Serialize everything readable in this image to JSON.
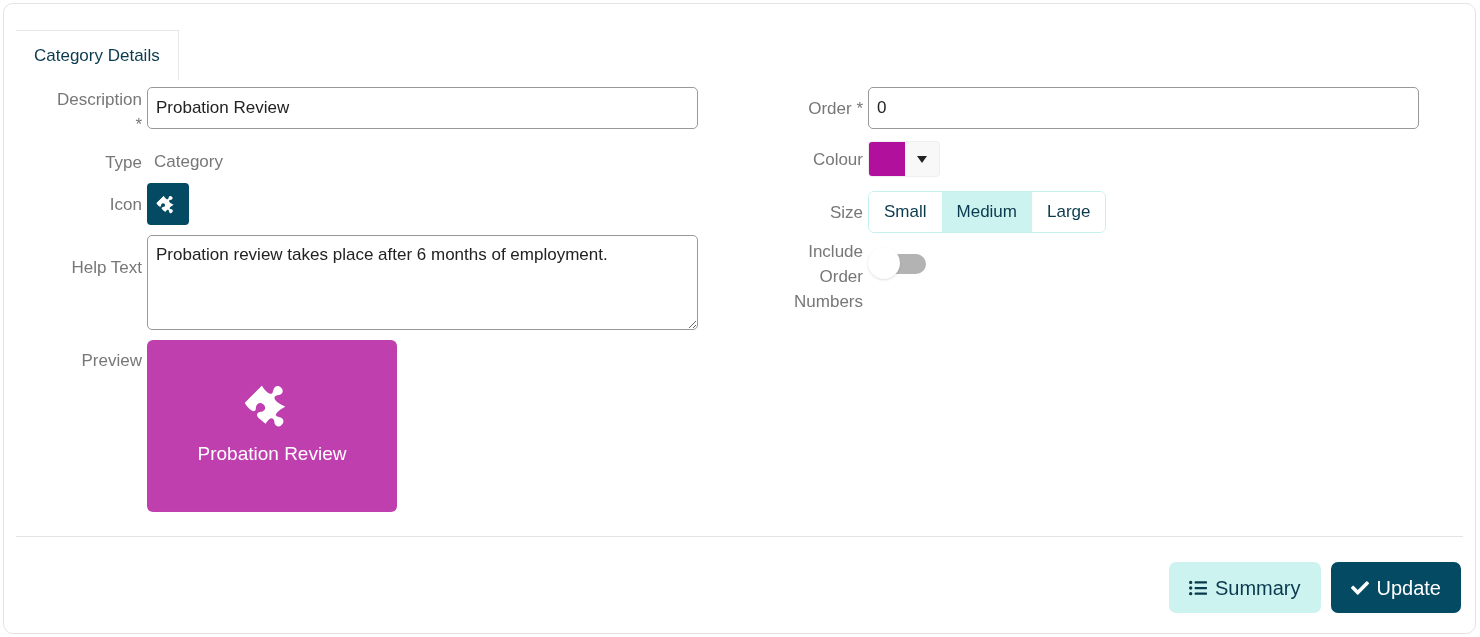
{
  "tabs": [
    {
      "label": "Category Details",
      "selected": true
    }
  ],
  "left": {
    "description": {
      "label": "Description",
      "required": "*",
      "value": "Probation Review"
    },
    "type": {
      "label": "Type",
      "value": "Category"
    },
    "icon": {
      "label": "Icon"
    },
    "help_text": {
      "label": "Help Text",
      "value": "Probation review takes place after 6 months of employment."
    },
    "preview": {
      "label": "Preview",
      "title": "Probation Review"
    }
  },
  "right": {
    "order": {
      "label": "Order *",
      "value": "0"
    },
    "colour": {
      "label": "Colour",
      "color": "#b0109c"
    },
    "size": {
      "label": "Size",
      "options": [
        {
          "label": "Small",
          "selected": false
        },
        {
          "label": "Medium",
          "selected": true
        },
        {
          "label": "Large",
          "selected": false
        }
      ]
    },
    "include_order_numbers": {
      "label": "Include Order Numbers",
      "on": false
    }
  },
  "buttons": [
    {
      "kind": "secondary",
      "label": "Summary"
    },
    {
      "kind": "primary",
      "label": "Update"
    }
  ]
}
